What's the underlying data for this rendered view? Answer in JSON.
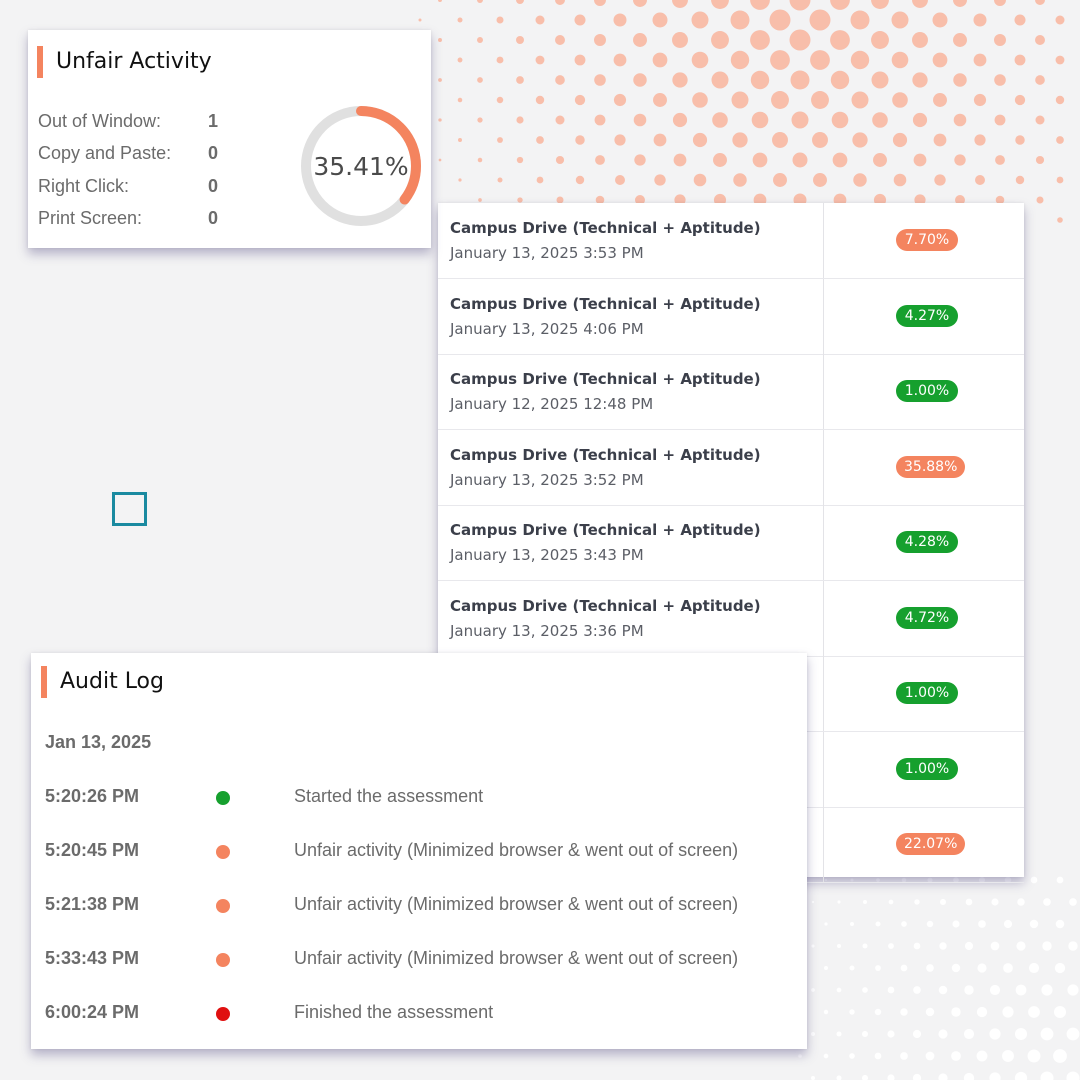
{
  "colors": {
    "accent": "#f4845f",
    "green": "#16a02e",
    "red": "#e01010",
    "donut_track": "#e0e0e0"
  },
  "unfair_activity": {
    "title": "Unfair Activity",
    "stats": [
      {
        "label": "Out of Window:",
        "value": "1"
      },
      {
        "label": "Copy and Paste:",
        "value": "0"
      },
      {
        "label": "Right Click:",
        "value": "0"
      },
      {
        "label": "Print Screen:",
        "value": "0"
      }
    ],
    "score_text": "35.41%",
    "score_fraction": 0.3541
  },
  "results": {
    "rows": [
      {
        "title": "Campus Drive (Technical + Aptitude)",
        "date": "January 13, 2025 3:53 PM",
        "score": "7.70%",
        "status": "orange"
      },
      {
        "title": "Campus Drive (Technical + Aptitude)",
        "date": "January 13, 2025 4:06 PM",
        "score": "4.27%",
        "status": "green"
      },
      {
        "title": "Campus Drive (Technical + Aptitude)",
        "date": "January 12, 2025 12:48 PM",
        "score": "1.00%",
        "status": "green"
      },
      {
        "title": "Campus Drive (Technical + Aptitude)",
        "date": "January 13, 2025 3:52 PM",
        "score": "35.88%",
        "status": "orange"
      },
      {
        "title": "Campus Drive (Technical + Aptitude)",
        "date": "January 13, 2025 3:43 PM",
        "score": "4.28%",
        "status": "green"
      },
      {
        "title": "Campus Drive (Technical + Aptitude)",
        "date": "January 13, 2025 3:36 PM",
        "score": "4.72%",
        "status": "green"
      },
      {
        "title": "",
        "date": "",
        "score": "1.00%",
        "status": "green"
      },
      {
        "title": "",
        "date": "",
        "score": "1.00%",
        "status": "green"
      },
      {
        "title": "",
        "date": "",
        "score": "22.07%",
        "status": "orange"
      }
    ]
  },
  "audit_log": {
    "title": "Audit Log",
    "date": "Jan 13, 2025",
    "entries": [
      {
        "time": "5:20:26 PM",
        "text": "Started the assessment",
        "status": "green"
      },
      {
        "time": "5:20:45 PM",
        "text": "Unfair activity (Minimized browser & went out of screen)",
        "status": "orange"
      },
      {
        "time": "5:21:38 PM",
        "text": "Unfair activity (Minimized browser & went out of screen)",
        "status": "orange"
      },
      {
        "time": "5:33:43 PM",
        "text": "Unfair activity (Minimized browser & went out of screen)",
        "status": "orange"
      },
      {
        "time": "6:00:24 PM",
        "text": "Finished the assessment",
        "status": "red"
      }
    ]
  }
}
